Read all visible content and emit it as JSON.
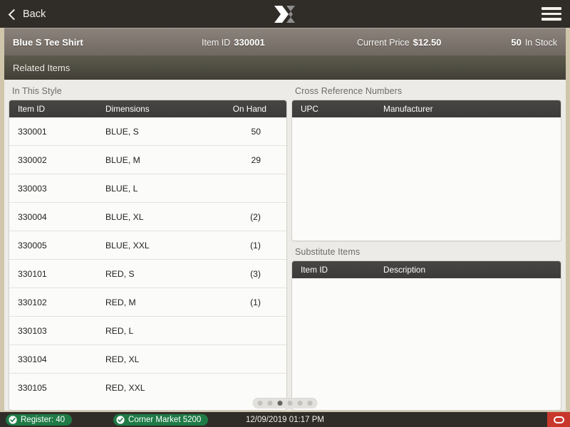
{
  "topbar": {
    "back_label": "Back",
    "logo_name": "x-logo",
    "menu_name": "hamburger-menu"
  },
  "item_bar": {
    "name": "Blue S Tee Shirt",
    "item_id_label": "Item ID",
    "item_id_value": "330001",
    "price_label": "Current Price",
    "price_value": "$12.50",
    "stock_value": "50",
    "stock_label": "In Stock"
  },
  "section": {
    "title": "Related Items"
  },
  "in_this_style": {
    "title": "In This Style",
    "columns": [
      "Item ID",
      "Dimensions",
      "On Hand"
    ],
    "rows": [
      {
        "id": "330001",
        "dim": "BLUE, S",
        "hand": "50"
      },
      {
        "id": "330002",
        "dim": "BLUE, M",
        "hand": "29"
      },
      {
        "id": "330003",
        "dim": "BLUE, L",
        "hand": ""
      },
      {
        "id": "330004",
        "dim": "BLUE, XL",
        "hand": "(2)"
      },
      {
        "id": "330005",
        "dim": "BLUE, XXL",
        "hand": "(1)"
      },
      {
        "id": "330101",
        "dim": "RED, S",
        "hand": "(3)"
      },
      {
        "id": "330102",
        "dim": "RED, M",
        "hand": "(1)"
      },
      {
        "id": "330103",
        "dim": "RED, L",
        "hand": ""
      },
      {
        "id": "330104",
        "dim": "RED, XL",
        "hand": ""
      },
      {
        "id": "330105",
        "dim": "RED, XXL",
        "hand": ""
      }
    ]
  },
  "cross_reference": {
    "title": "Cross Reference Numbers",
    "columns": [
      "UPC",
      "Manufacturer"
    ],
    "rows": []
  },
  "substitute_items": {
    "title": "Substitute Items",
    "columns": [
      "Item ID",
      "Description"
    ],
    "rows": []
  },
  "pager": {
    "count": 6,
    "active_index": 2
  },
  "footer": {
    "register": "Register: 40",
    "store": "Corner Market 5200",
    "timestamp": "12/09/2019 01:17 PM",
    "power_name": "power-button"
  },
  "colors": {
    "accent_beige": "#cfc6ab",
    "topbar": "#302d28",
    "item_bar": "#7d756d",
    "section_bar": "#4e4d41",
    "table_header": "#3f3e3c",
    "badge_green": "#1f7a46",
    "power_red": "#c8372c"
  }
}
